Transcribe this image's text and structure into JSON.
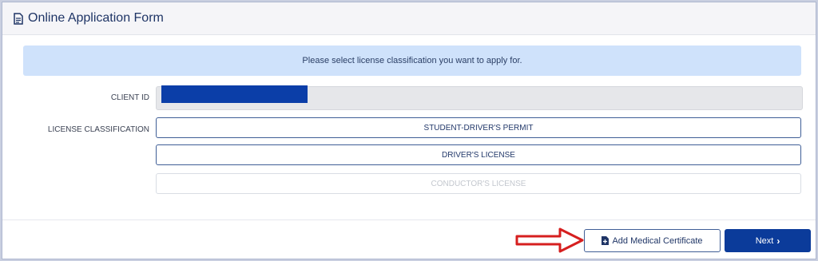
{
  "header": {
    "title": "Online Application Form",
    "icon": "document-icon"
  },
  "banner": {
    "message": "Please select license classification you want to apply for."
  },
  "form": {
    "client_id_label": "CLIENT ID",
    "client_id_value": "",
    "classification_label": "LICENSE CLASSIFICATION",
    "options": [
      {
        "label": "STUDENT-DRIVER'S PERMIT",
        "enabled": true
      },
      {
        "label": "DRIVER'S LICENSE",
        "enabled": true
      },
      {
        "label": "CONDUCTOR'S LICENSE",
        "enabled": false
      }
    ]
  },
  "footer": {
    "add_medical_label": "Add Medical Certificate",
    "next_label": "Next",
    "add_medical_icon": "file-plus-icon",
    "next_icon": "chevron-right-icon"
  },
  "annotation": {
    "arrow_color": "#d61f1f"
  },
  "colors": {
    "primary": "#0b3b9a",
    "banner": "#cfe2fb",
    "border": "#3f5e96"
  }
}
